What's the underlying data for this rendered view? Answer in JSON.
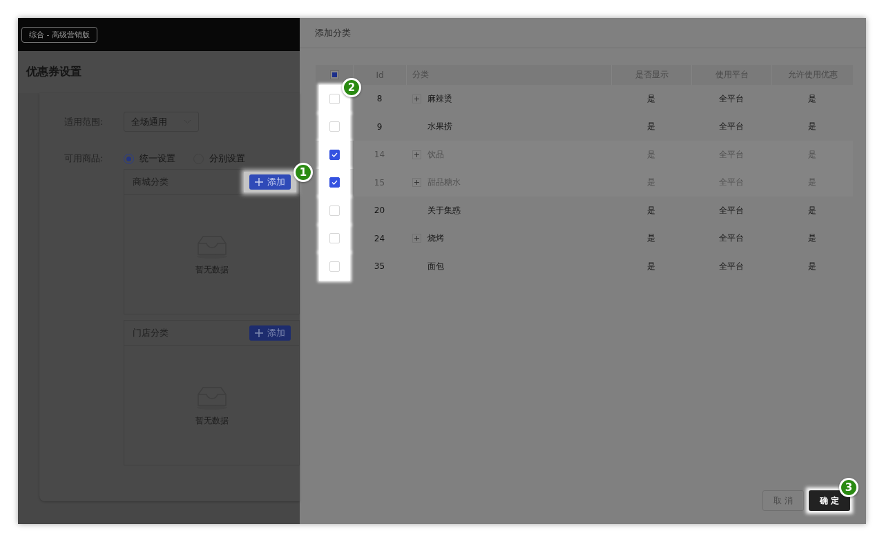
{
  "header": {
    "edition_tag": "综合 - 高级营销版"
  },
  "page": {
    "title": "优惠券设置"
  },
  "form": {
    "scope": {
      "label": "适用范围:",
      "value": "全场通用"
    },
    "goods": {
      "label": "可用商品:",
      "options": [
        {
          "label": "统一设置",
          "selected": true
        },
        {
          "label": "分别设置",
          "selected": false
        }
      ]
    },
    "panels": [
      {
        "title": "商城分类",
        "add_button": "添加",
        "empty_text": "暂无数据",
        "callout": "1"
      },
      {
        "title": "门店分类",
        "add_button": "添加",
        "empty_text": "暂无数据"
      }
    ]
  },
  "drawer": {
    "title": "添加分类",
    "table": {
      "select_all": {
        "checked": false,
        "indeterminate": true
      },
      "callout": "2",
      "columns": [
        "Id",
        "分类",
        "是否显示",
        "使用平台",
        "允许使用优惠"
      ],
      "rows": [
        {
          "selected": false,
          "id": "8",
          "name": "麻辣烫",
          "expandable": true,
          "shown": "是",
          "platform": "全平台",
          "discount": "是"
        },
        {
          "selected": false,
          "id": "9",
          "name": "水果捞",
          "expandable": false,
          "shown": "是",
          "platform": "全平台",
          "discount": "是"
        },
        {
          "selected": true,
          "id": "14",
          "name": "饮品",
          "expandable": true,
          "shown": "是",
          "platform": "全平台",
          "discount": "是"
        },
        {
          "selected": true,
          "id": "15",
          "name": "甜品糖水",
          "expandable": true,
          "shown": "是",
          "platform": "全平台",
          "discount": "是"
        },
        {
          "selected": false,
          "id": "20",
          "name": "关于集惑",
          "expandable": false,
          "shown": "是",
          "platform": "全平台",
          "discount": "是"
        },
        {
          "selected": false,
          "id": "24",
          "name": "烧烤",
          "expandable": true,
          "shown": "是",
          "platform": "全平台",
          "discount": "是"
        },
        {
          "selected": false,
          "id": "35",
          "name": "面包",
          "expandable": false,
          "shown": "是",
          "platform": "全平台",
          "discount": "是"
        }
      ]
    },
    "buttons": {
      "cancel": "取 消",
      "confirm": "确 定",
      "confirm_callout": "3"
    }
  }
}
